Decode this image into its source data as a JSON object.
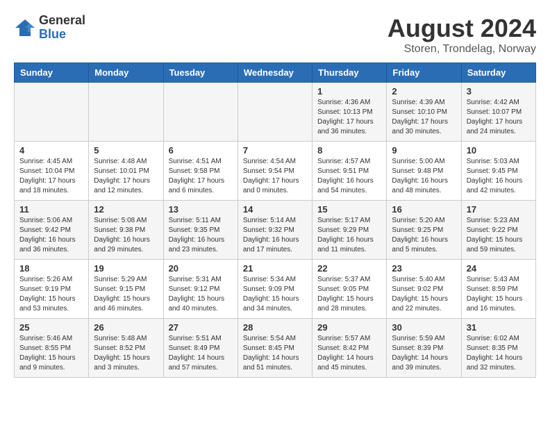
{
  "header": {
    "logo_general": "General",
    "logo_blue": "Blue",
    "month_title": "August 2024",
    "location": "Storen, Trondelag, Norway"
  },
  "days_of_week": [
    "Sunday",
    "Monday",
    "Tuesday",
    "Wednesday",
    "Thursday",
    "Friday",
    "Saturday"
  ],
  "weeks": [
    [
      {
        "day": "",
        "info": ""
      },
      {
        "day": "",
        "info": ""
      },
      {
        "day": "",
        "info": ""
      },
      {
        "day": "",
        "info": ""
      },
      {
        "day": "1",
        "info": "Sunrise: 4:36 AM\nSunset: 10:13 PM\nDaylight: 17 hours\nand 36 minutes."
      },
      {
        "day": "2",
        "info": "Sunrise: 4:39 AM\nSunset: 10:10 PM\nDaylight: 17 hours\nand 30 minutes."
      },
      {
        "day": "3",
        "info": "Sunrise: 4:42 AM\nSunset: 10:07 PM\nDaylight: 17 hours\nand 24 minutes."
      }
    ],
    [
      {
        "day": "4",
        "info": "Sunrise: 4:45 AM\nSunset: 10:04 PM\nDaylight: 17 hours\nand 18 minutes."
      },
      {
        "day": "5",
        "info": "Sunrise: 4:48 AM\nSunset: 10:01 PM\nDaylight: 17 hours\nand 12 minutes."
      },
      {
        "day": "6",
        "info": "Sunrise: 4:51 AM\nSunset: 9:58 PM\nDaylight: 17 hours\nand 6 minutes."
      },
      {
        "day": "7",
        "info": "Sunrise: 4:54 AM\nSunset: 9:54 PM\nDaylight: 17 hours\nand 0 minutes."
      },
      {
        "day": "8",
        "info": "Sunrise: 4:57 AM\nSunset: 9:51 PM\nDaylight: 16 hours\nand 54 minutes."
      },
      {
        "day": "9",
        "info": "Sunrise: 5:00 AM\nSunset: 9:48 PM\nDaylight: 16 hours\nand 48 minutes."
      },
      {
        "day": "10",
        "info": "Sunrise: 5:03 AM\nSunset: 9:45 PM\nDaylight: 16 hours\nand 42 minutes."
      }
    ],
    [
      {
        "day": "11",
        "info": "Sunrise: 5:06 AM\nSunset: 9:42 PM\nDaylight: 16 hours\nand 36 minutes."
      },
      {
        "day": "12",
        "info": "Sunrise: 5:08 AM\nSunset: 9:38 PM\nDaylight: 16 hours\nand 29 minutes."
      },
      {
        "day": "13",
        "info": "Sunrise: 5:11 AM\nSunset: 9:35 PM\nDaylight: 16 hours\nand 23 minutes."
      },
      {
        "day": "14",
        "info": "Sunrise: 5:14 AM\nSunset: 9:32 PM\nDaylight: 16 hours\nand 17 minutes."
      },
      {
        "day": "15",
        "info": "Sunrise: 5:17 AM\nSunset: 9:29 PM\nDaylight: 16 hours\nand 11 minutes."
      },
      {
        "day": "16",
        "info": "Sunrise: 5:20 AM\nSunset: 9:25 PM\nDaylight: 16 hours\nand 5 minutes."
      },
      {
        "day": "17",
        "info": "Sunrise: 5:23 AM\nSunset: 9:22 PM\nDaylight: 15 hours\nand 59 minutes."
      }
    ],
    [
      {
        "day": "18",
        "info": "Sunrise: 5:26 AM\nSunset: 9:19 PM\nDaylight: 15 hours\nand 53 minutes."
      },
      {
        "day": "19",
        "info": "Sunrise: 5:29 AM\nSunset: 9:15 PM\nDaylight: 15 hours\nand 46 minutes."
      },
      {
        "day": "20",
        "info": "Sunrise: 5:31 AM\nSunset: 9:12 PM\nDaylight: 15 hours\nand 40 minutes."
      },
      {
        "day": "21",
        "info": "Sunrise: 5:34 AM\nSunset: 9:09 PM\nDaylight: 15 hours\nand 34 minutes."
      },
      {
        "day": "22",
        "info": "Sunrise: 5:37 AM\nSunset: 9:05 PM\nDaylight: 15 hours\nand 28 minutes."
      },
      {
        "day": "23",
        "info": "Sunrise: 5:40 AM\nSunset: 9:02 PM\nDaylight: 15 hours\nand 22 minutes."
      },
      {
        "day": "24",
        "info": "Sunrise: 5:43 AM\nSunset: 8:59 PM\nDaylight: 15 hours\nand 16 minutes."
      }
    ],
    [
      {
        "day": "25",
        "info": "Sunrise: 5:46 AM\nSunset: 8:55 PM\nDaylight: 15 hours\nand 9 minutes."
      },
      {
        "day": "26",
        "info": "Sunrise: 5:48 AM\nSunset: 8:52 PM\nDaylight: 15 hours\nand 3 minutes."
      },
      {
        "day": "27",
        "info": "Sunrise: 5:51 AM\nSunset: 8:49 PM\nDaylight: 14 hours\nand 57 minutes."
      },
      {
        "day": "28",
        "info": "Sunrise: 5:54 AM\nSunset: 8:45 PM\nDaylight: 14 hours\nand 51 minutes."
      },
      {
        "day": "29",
        "info": "Sunrise: 5:57 AM\nSunset: 8:42 PM\nDaylight: 14 hours\nand 45 minutes."
      },
      {
        "day": "30",
        "info": "Sunrise: 5:59 AM\nSunset: 8:39 PM\nDaylight: 14 hours\nand 39 minutes."
      },
      {
        "day": "31",
        "info": "Sunrise: 6:02 AM\nSunset: 8:35 PM\nDaylight: 14 hours\nand 32 minutes."
      }
    ]
  ]
}
